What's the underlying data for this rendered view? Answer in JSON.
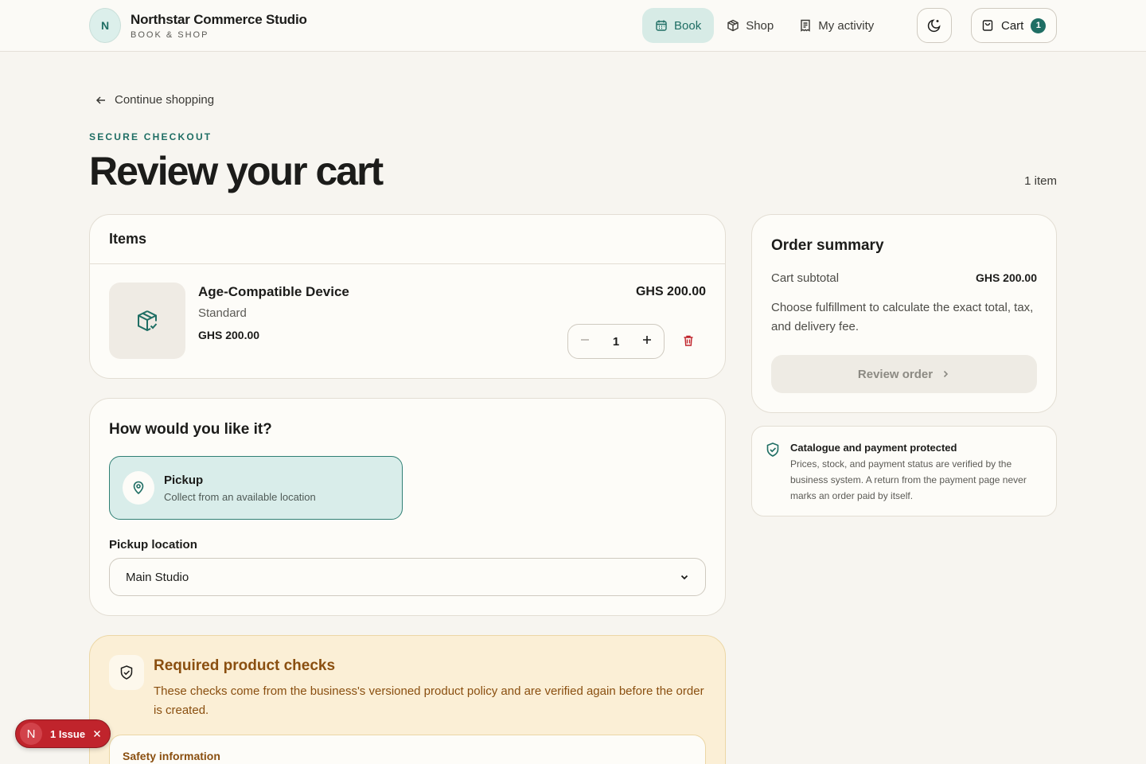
{
  "header": {
    "brand_initial": "N",
    "brand_name": "Northstar Commerce Studio",
    "brand_sub": "BOOK & SHOP",
    "nav": [
      {
        "label": "Book",
        "icon": "calendar-icon",
        "active": true
      },
      {
        "label": "Shop",
        "icon": "package-icon",
        "active": false
      },
      {
        "label": "My activity",
        "icon": "receipt-icon",
        "active": false
      }
    ],
    "theme_icon": "moon-icon",
    "cart_label": "Cart",
    "cart_count": "1"
  },
  "page": {
    "back_label": "Continue shopping",
    "eyebrow": "SECURE CHECKOUT",
    "title": "Review your cart",
    "item_count": "1 item"
  },
  "items": {
    "heading": "Items",
    "list": [
      {
        "name": "Age-Compatible Device",
        "variant": "Standard",
        "unit_price": "GHS 200.00",
        "line_total": "GHS 200.00",
        "quantity": "1"
      }
    ]
  },
  "fulfillment": {
    "heading": "How would you like it?",
    "option_label": "Pickup",
    "option_desc": "Collect from an available location",
    "location_label": "Pickup location",
    "location_value": "Main Studio"
  },
  "checks": {
    "heading": "Required product checks",
    "description": "These checks come from the business's versioned product policy and are verified again before the order is created.",
    "section_title": "Safety information"
  },
  "summary": {
    "heading": "Order summary",
    "subtotal_label": "Cart subtotal",
    "subtotal_value": "GHS 200.00",
    "note": "Choose fulfillment to calculate the exact total, tax, and delivery fee.",
    "button_label": "Review order"
  },
  "protection": {
    "title": "Catalogue and payment protected",
    "description": "Prices, stock, and payment status are verified by the business system. A return from the payment page never marks an order paid by itself."
  },
  "issue_toast": {
    "initial": "N",
    "label": "1 Issue"
  },
  "colors": {
    "accent": "#1f6e64",
    "danger": "#c0242c",
    "warning_text": "#8a4f10"
  }
}
